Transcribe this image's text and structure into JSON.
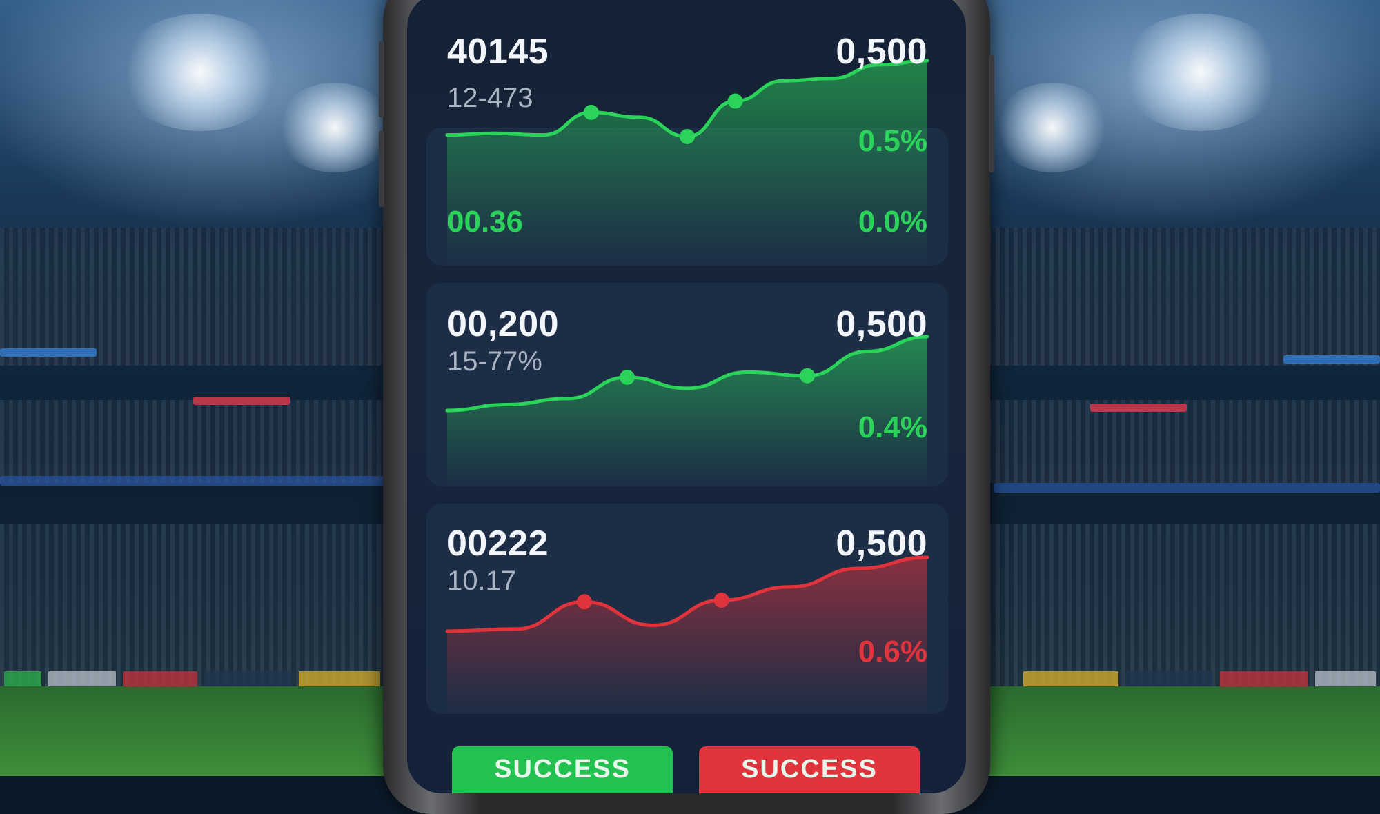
{
  "cards": [
    {
      "value": "40145",
      "sub": "12-473",
      "price": "0,500",
      "change_top": "0.5%",
      "left_bottom": "00.36",
      "change_bottom": "0.0%",
      "trend": "up",
      "color": "#2bd35a",
      "series": [
        0.08,
        0.1,
        0.08,
        0.36,
        0.3,
        0.06,
        0.5,
        0.75,
        0.78,
        0.95,
        1.0
      ]
    },
    {
      "value": "00,200",
      "sub": "15-77%",
      "price": "0,500",
      "change": "0.4%",
      "trend": "up",
      "color": "#2bd35a",
      "series": [
        0.0,
        0.08,
        0.16,
        0.45,
        0.3,
        0.52,
        0.47,
        0.8,
        1.0
      ]
    },
    {
      "value": "00222",
      "sub": "10.17",
      "price": "0,500",
      "change": "0.6%",
      "trend": "down",
      "color": "#e1333b",
      "series": [
        0.0,
        0.03,
        0.4,
        0.08,
        0.42,
        0.6,
        0.85,
        1.0
      ]
    }
  ],
  "buttons": {
    "left_label": "SUCCESS",
    "right_label": "SUCCESS"
  },
  "colors": {
    "positive": "#2bd35a",
    "negative": "#e1333b",
    "card_bg": "#1c2d45",
    "screen_bg": "#152236"
  }
}
